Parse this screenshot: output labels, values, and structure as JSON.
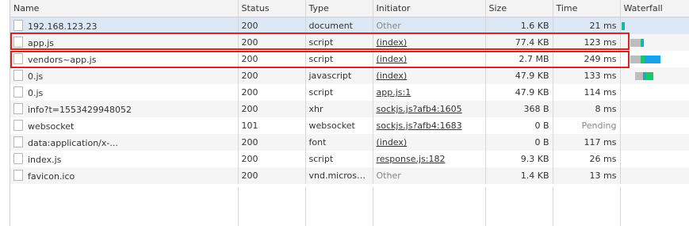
{
  "columns": {
    "name": "Name",
    "status": "Status",
    "type": "Type",
    "initiator": "Initiator",
    "size": "Size",
    "time": "Time",
    "waterfall": "Waterfall"
  },
  "rows": [
    {
      "name": "192.168.123.23",
      "status": "200",
      "type": "document",
      "initiator": "Other",
      "size": "1.6 KB",
      "time": "21 ms"
    },
    {
      "name": "app.js",
      "status": "200",
      "type": "script",
      "initiator": "(index)",
      "size": "77.4 KB",
      "time": "123 ms"
    },
    {
      "name": "vendors~app.js",
      "status": "200",
      "type": "script",
      "initiator": "(index)",
      "size": "2.7 MB",
      "time": "249 ms"
    },
    {
      "name": "0.js",
      "status": "200",
      "type": "javascript",
      "initiator": "(index)",
      "size": "47.9 KB",
      "time": "133 ms"
    },
    {
      "name": "0.js",
      "status": "200",
      "type": "script",
      "initiator": "app.js:1",
      "size": "47.9 KB",
      "time": "114 ms"
    },
    {
      "name": "info?t=1553429948052",
      "status": "200",
      "type": "xhr",
      "initiator": "sockjs.js?afb4:1605",
      "size": "368 B",
      "time": "8 ms"
    },
    {
      "name": "websocket",
      "status": "101",
      "type": "websocket",
      "initiator": "sockjs.js?afb4:1683",
      "size": "0 B",
      "time": "Pending"
    },
    {
      "name": "data:application/x-...",
      "status": "200",
      "type": "font",
      "initiator": "(index)",
      "size": "0 B",
      "time": "117 ms"
    },
    {
      "name": "index.js",
      "status": "200",
      "type": "script",
      "initiator": "response.js:182",
      "size": "9.3 KB",
      "time": "26 ms"
    },
    {
      "name": "favicon.ico",
      "status": "200",
      "type": "vnd.microsof...",
      "initiator": "Other",
      "size": "1.4 KB",
      "time": "13 ms"
    }
  ],
  "colors": {
    "highlight": "#e02020",
    "waiting": "#bdbdbd",
    "download": "#1aa3e8",
    "ttfb": "#1fc46a",
    "selected_row": "#dde8f6"
  }
}
